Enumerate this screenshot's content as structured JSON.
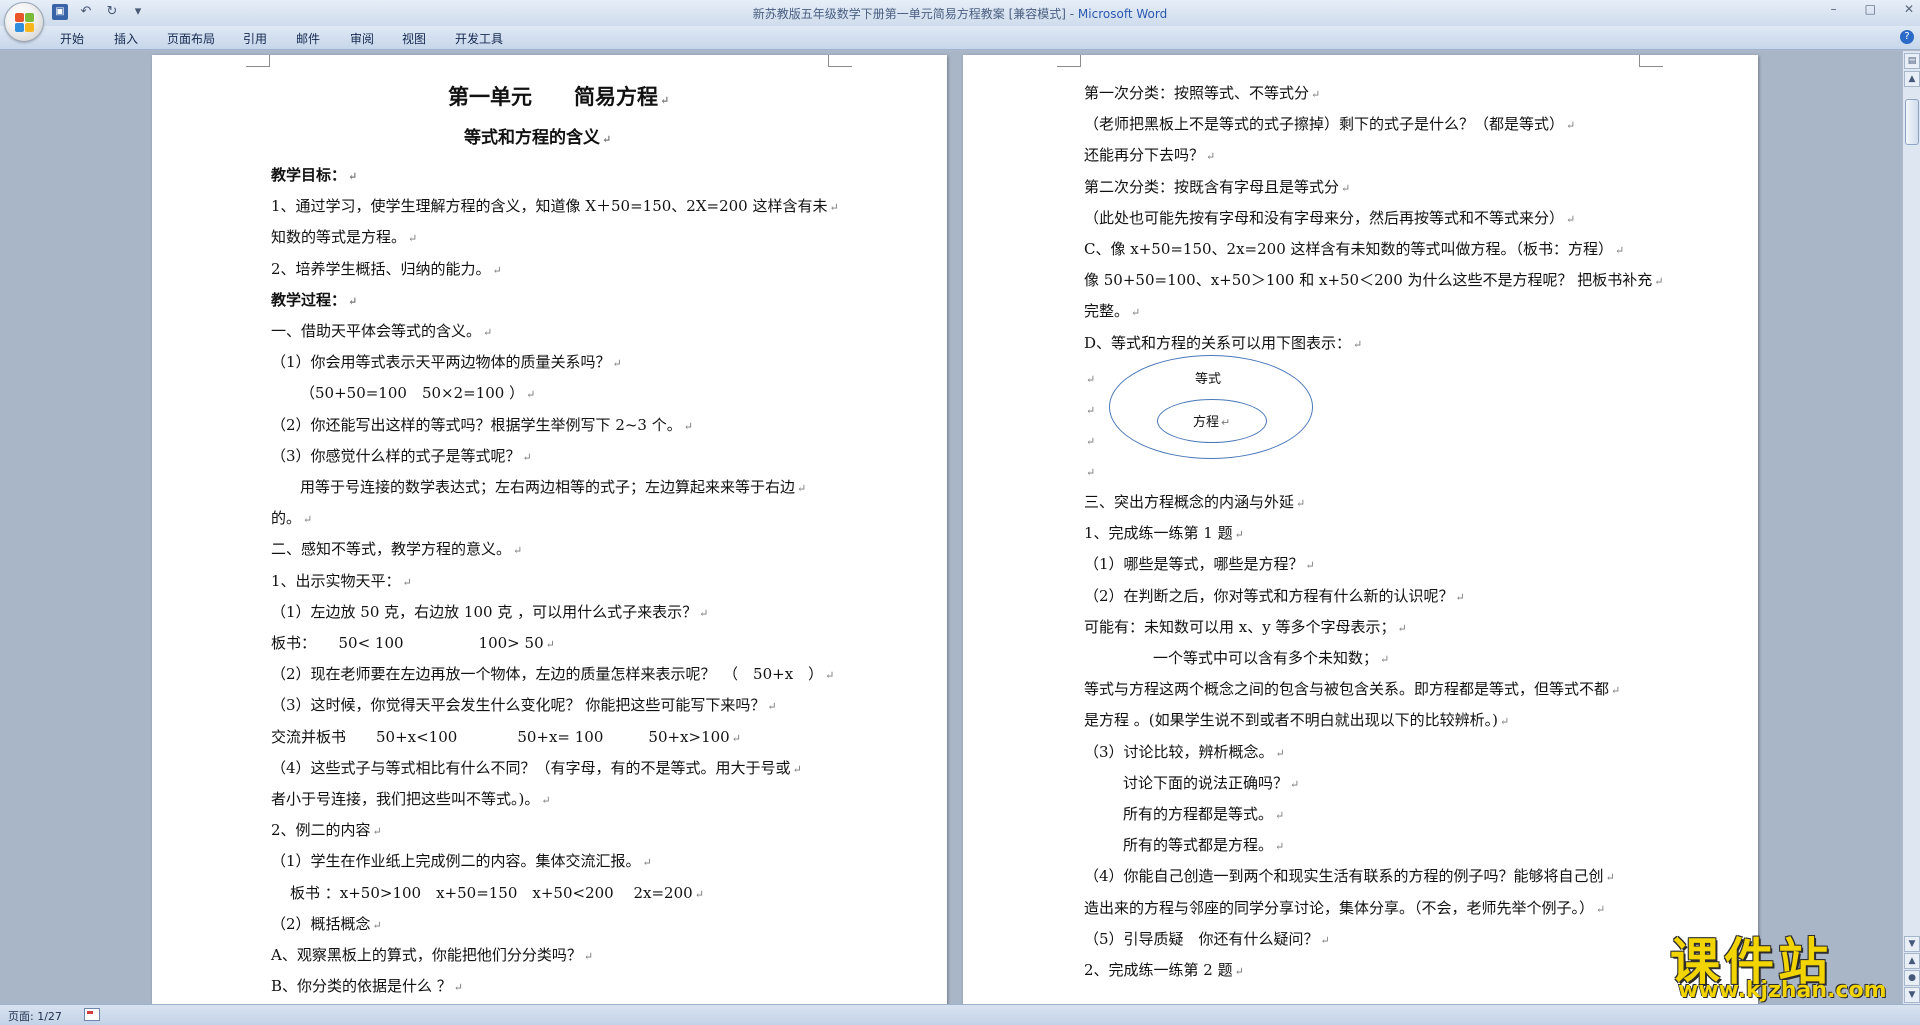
{
  "window": {
    "title_doc": "新苏教版五年级数学下册第一单元简易方程教案 [兼容模式] - ",
    "title_app": "Microsoft Word",
    "min": "–",
    "max": "□",
    "close": "✕"
  },
  "ribbon": {
    "tabs": [
      "开始",
      "插入",
      "页面布局",
      "引用",
      "邮件",
      "审阅",
      "视图",
      "开发工具"
    ],
    "help": "?"
  },
  "left_page": {
    "title": "第一单元　　简易方程",
    "subtitle": "等式和方程的含义",
    "lines": [
      {
        "text": "教学目标：",
        "bold": true
      },
      {
        "text": "1、通过学习，使学生理解方程的含义，知道像 X＋50=150、2X=200 这样含有未"
      },
      {
        "text": "知数的等式是方程。"
      },
      {
        "text": "2、培养学生概括、归纳的能力。"
      },
      {
        "text": "教学过程：",
        "bold": true
      },
      {
        "text": "一、借助天平体会等式的含义。"
      },
      {
        "text": "（1）你会用等式表示天平两边物体的质量关系吗？"
      },
      {
        "text": "（50+50=100　50×2=100 ）",
        "indent": true
      },
      {
        "text": "（2）你还能写出这样的等式吗？根据学生举例写下 2~3 个。"
      },
      {
        "text": "（3）你感觉什么样的式子是等式呢？"
      },
      {
        "text": "用等于号连接的数学表达式；左右两边相等的式子；左边算起来来等于右边",
        "indent": true
      },
      {
        "text": "的。"
      },
      {
        "text": "二、感知不等式，教学方程的意义。"
      },
      {
        "text": "1、出示实物天平："
      },
      {
        "text": "（1）左边放 50 克，右边放 100 克 ，可以用什么式子来表示？"
      },
      {
        "text": "板书：　　50< 100　　　　　100> 50"
      },
      {
        "text": "（2）现在老师要在左边再放一个物体，左边的质量怎样来表示呢？　（　50+x　）"
      },
      {
        "text": "（3）这时候，你觉得天平会发生什么变化呢？ 你能把这些可能写下来吗？"
      },
      {
        "text": "交流并板书　　50+x<100　　　　50+x= 100　　　50+x>100"
      },
      {
        "text": "（4）这些式子与等式相比有什么不同？（有字母，有的不是等式。用大于号或"
      },
      {
        "text": "者小于号连接，我们把这些叫不等式。)。"
      },
      {
        "text": "2、例二的内容"
      },
      {
        "text": "（1）学生在作业纸上完成例二的内容。集体交流汇报。"
      },
      {
        "text": "板书 ：x+50>100　x+50=150　x+50<200　 2x=200",
        "indent": true
      },
      {
        "text": "（2）概括概念"
      },
      {
        "text": "A、观察黑板上的算式，你能把他们分分类吗？"
      },
      {
        "text": "B、你分类的依据是什么 ？"
      }
    ]
  },
  "right_page": {
    "lines_top": [
      "第一次分类：按照等式、不等式分",
      "（老师把黑板上不是等式的式子擦掉）剩下的式子是什么？（都是等式）",
      "还能再分下去吗？",
      "第二次分类：按既含有字母且是等式分",
      "（此处也可能先按有字母和没有字母来分，然后再按等式和不等式来分）",
      "C、像 x+50=150、2x=200 这样含有未知数的等式叫做方程。（板书：方程）",
      "像 50+50=100、x+50＞100 和 x+50＜200 为什么这些不是方程呢？ 把板书补充",
      "完整。",
      "D、等式和方程的关系可以用下图表示："
    ],
    "diagram": {
      "outer_label": "等式",
      "inner_label": "方程"
    },
    "lines_bottom": [
      {
        "text": "三、突出方程概念的内涵与外延"
      },
      {
        "text": "1、完成练一练第 1 题"
      },
      {
        "text": "（1）哪些是等式，哪些是方程？"
      },
      {
        "text": "（2）在判断之后，你对等式和方程有什么新的认识呢？"
      },
      {
        "text": "可能有：未知数可以用 x、y 等多个字母表示；"
      },
      {
        "text": "一个等式中可以含有多个未知数；",
        "indent": true
      },
      {
        "text": "等式与方程这两个概念之间的包含与被包含关系。即方程都是等式，但等式不都"
      },
      {
        "text": "是方程 。(如果学生说不到或者不明白就出现以下的比较辨析。)"
      },
      {
        "text": "（3）讨论比较，辨析概念。"
      },
      {
        "text": "讨论下面的说法正确吗？",
        "indent": true
      },
      {
        "text": "所有的方程都是等式。",
        "indent": true
      },
      {
        "text": "所有的等式都是方程。",
        "indent": true
      },
      {
        "text": "（4）你能自己创造一到两个和现实生活有联系的方程的例子吗？能够将自己创"
      },
      {
        "text": "造出来的方程与邻座的同学分享讨论，集体分享。（不会，老师先举个例子。）"
      },
      {
        "text": "（5）引导质疑　你还有什么疑问？"
      },
      {
        "text": "2、完成练一练第 2 题"
      }
    ]
  },
  "status": {
    "page": "页面: 1/27"
  },
  "watermark": {
    "main": "课件站",
    "url": "www.kjzhan.com"
  },
  "colors": {
    "accent": "#2a58b0",
    "workspace": "#a9b6c8",
    "watermark": "#f2d400"
  }
}
